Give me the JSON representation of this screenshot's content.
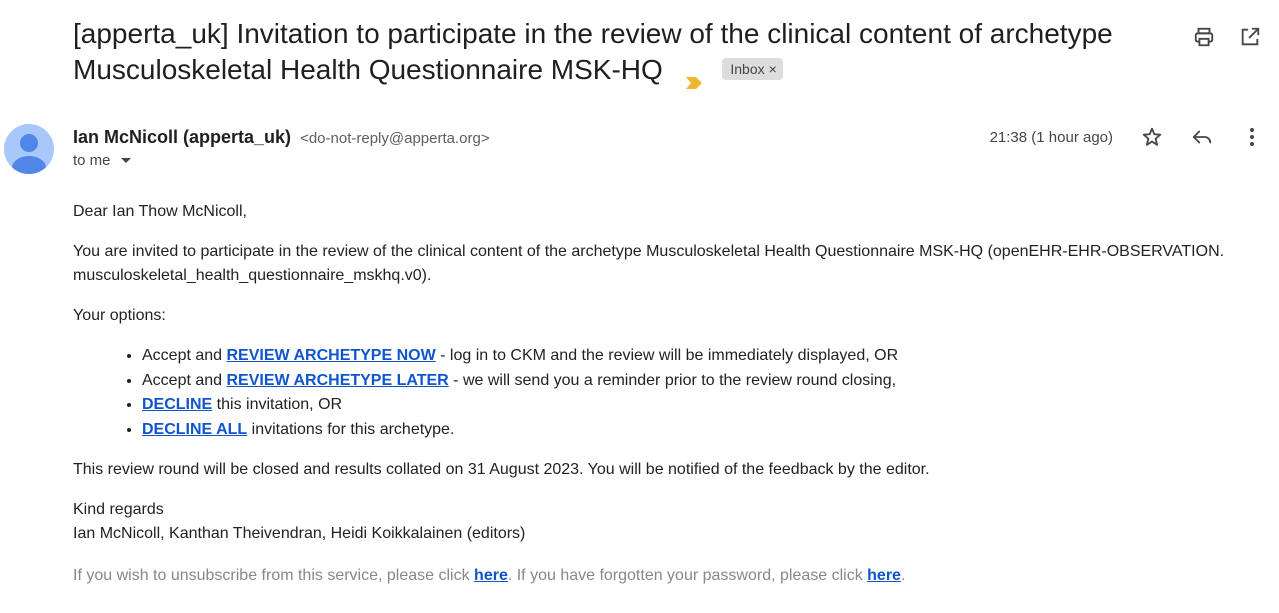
{
  "subject": {
    "title": "[apperta_uk] Invitation to participate in the review of the clinical content of archetype Musculoskeletal Health Questionnaire MSK-HQ",
    "label": "Inbox",
    "label_remove": "×",
    "importance_color": "#f2b530"
  },
  "toolbar": {
    "print_icon": "print-icon",
    "open_new_window_icon": "open-in-new-icon"
  },
  "sender": {
    "name": "Ian McNicoll (apperta_uk)",
    "email": "<do-not-reply@apperta.org>",
    "to_label": "to me",
    "time": "21:38 (1 hour ago)"
  },
  "body": {
    "greeting": "Dear Ian Thow McNicoll,",
    "intro": "You are invited to participate in the review of the clinical content of the archetype Musculoskeletal Health Questionnaire MSK-HQ (openEHR-EHR-OBSERVATION. musculoskeletal_health_questionnaire_mskhq.v0).",
    "options_heading": "Your options:",
    "options": [
      {
        "prefix": "Accept and ",
        "link": "REVIEW ARCHETYPE NOW",
        "suffix": " - log in to CKM and the review will be immediately displayed, OR"
      },
      {
        "prefix": "Accept and ",
        "link": "REVIEW ARCHETYPE LATER",
        "suffix": " - we will send you a reminder prior to the review round closing,"
      },
      {
        "prefix": "",
        "link": "DECLINE",
        "suffix": " this invitation, OR"
      },
      {
        "prefix": "",
        "link": "DECLINE ALL",
        "suffix": " invitations for this archetype."
      }
    ],
    "closing_note": "This review round will be closed and results collated on 31 August 2023. You will be notified of the feedback by the editor.",
    "regards": "Kind regards",
    "signature": "Ian McNicoll, Kanthan Theivendran, Heidi Koikkalainen (editors)",
    "footer": {
      "unsubscribe_text": "If you wish to unsubscribe from this service, please click ",
      "unsubscribe_link": "here",
      "password_text": ". If you have forgotten your password, please click ",
      "password_link": "here",
      "end": "."
    }
  },
  "colors": {
    "link": "#1155cc",
    "avatar_bg": "#a8c7fa",
    "avatar_fg": "#4f86e8"
  }
}
